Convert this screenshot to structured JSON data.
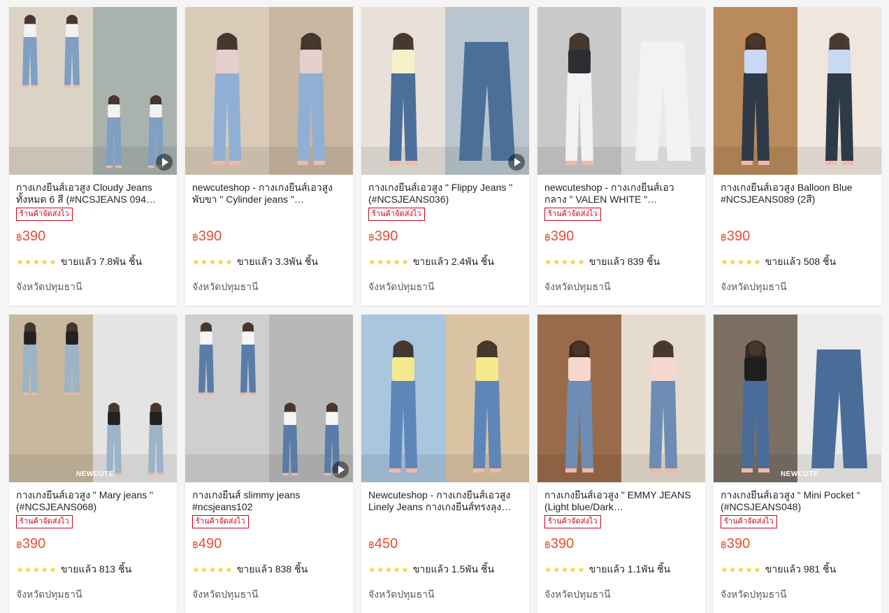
{
  "shop_badge": "ร้านค้าจัดส่งไว",
  "currency_symbol": "฿",
  "colors": {
    "price": "#ee4d2d",
    "badge": "#d0011b",
    "star": "#ffce3d"
  },
  "products": [
    {
      "name": "กางเกงยีนส์เอวสูง Cloudy Jeans ทั้งหมด 6 สี (#NCSJEANS 094…",
      "has_badge": true,
      "price": "390",
      "rating": 5,
      "sold": "ขายแล้ว 7.8พัน ชิ้น",
      "location": "จังหวัดปทุมธานี",
      "has_video": true,
      "brand_mark": ""
    },
    {
      "name": "newcuteshop - กางเกงยีนส์เอวสูง พับขา \" Cylinder jeans \"…",
      "has_badge": false,
      "price": "390",
      "rating": 5,
      "sold": "ขายแล้ว 3.3พัน ชิ้น",
      "location": "จังหวัดปทุมธานี",
      "has_video": false,
      "brand_mark": ""
    },
    {
      "name": "กางเกงยีนส์เอวสูง \" Flippy Jeans \" (#NCSJEANS036)",
      "has_badge": true,
      "price": "390",
      "rating": 5,
      "sold": "ขายแล้ว 2.4พัน ชิ้น",
      "location": "จังหวัดปทุมธานี",
      "has_video": true,
      "brand_mark": ""
    },
    {
      "name": "newcuteshop - กางเกงยีนส์เอว กลาง \" VALEN WHITE \"…",
      "has_badge": true,
      "price": "390",
      "rating": 5,
      "sold": "ขายแล้ว 839 ชิ้น",
      "location": "จังหวัดปทุมธานี",
      "has_video": false,
      "brand_mark": ""
    },
    {
      "name": "กางเกงยีนส์เอวสูง Balloon Blue #NCSJEANS089 (2สี)",
      "has_badge": false,
      "price": "390",
      "rating": 5,
      "sold": "ขายแล้ว 508 ชิ้น",
      "location": "จังหวัดปทุมธานี",
      "has_video": false,
      "brand_mark": ""
    },
    {
      "name": "กางเกงยีนส์เอวสูง \" Mary jeans \" (#NCSJEANS068)",
      "has_badge": true,
      "price": "390",
      "rating": 5,
      "sold": "ขายแล้ว 813 ชิ้น",
      "location": "จังหวัดปทุมธานี",
      "has_video": false,
      "brand_mark": "NEWCUTE"
    },
    {
      "name": "กางเกงยีนส์ slimmy jeans #ncsjeans102",
      "has_badge": true,
      "price": "490",
      "rating": 5,
      "sold": "ขายแล้ว 838 ชิ้น",
      "location": "จังหวัดปทุมธานี",
      "has_video": true,
      "brand_mark": ""
    },
    {
      "name": "Newcuteshop - กางเกงยีนส์เอวสูง Linely Jeans กางเกงยีนส์ทรงลุง…",
      "has_badge": false,
      "price": "450",
      "rating": 5,
      "sold": "ขายแล้ว 1.5พัน ชิ้น",
      "location": "จังหวัดปทุมธานี",
      "has_video": false,
      "brand_mark": ""
    },
    {
      "name": "กางเกงยีนส์เอวสูง \" EMMY JEANS (Light blue/Dark…",
      "has_badge": true,
      "price": "390",
      "rating": 5,
      "sold": "ขายแล้ว 1.1พัน ชิ้น",
      "location": "จังหวัดปทุมธานี",
      "has_video": false,
      "brand_mark": ""
    },
    {
      "name": "กางเกงยีนส์เอวสูง “ Mini Pocket “ (#NCSJEANS048)",
      "has_badge": true,
      "price": "390",
      "rating": 5,
      "sold": "ขายแล้ว 981 ชิ้น",
      "location": "จังหวัดปทุมธานี",
      "has_video": false,
      "brand_mark": "NEWCUTE"
    }
  ]
}
